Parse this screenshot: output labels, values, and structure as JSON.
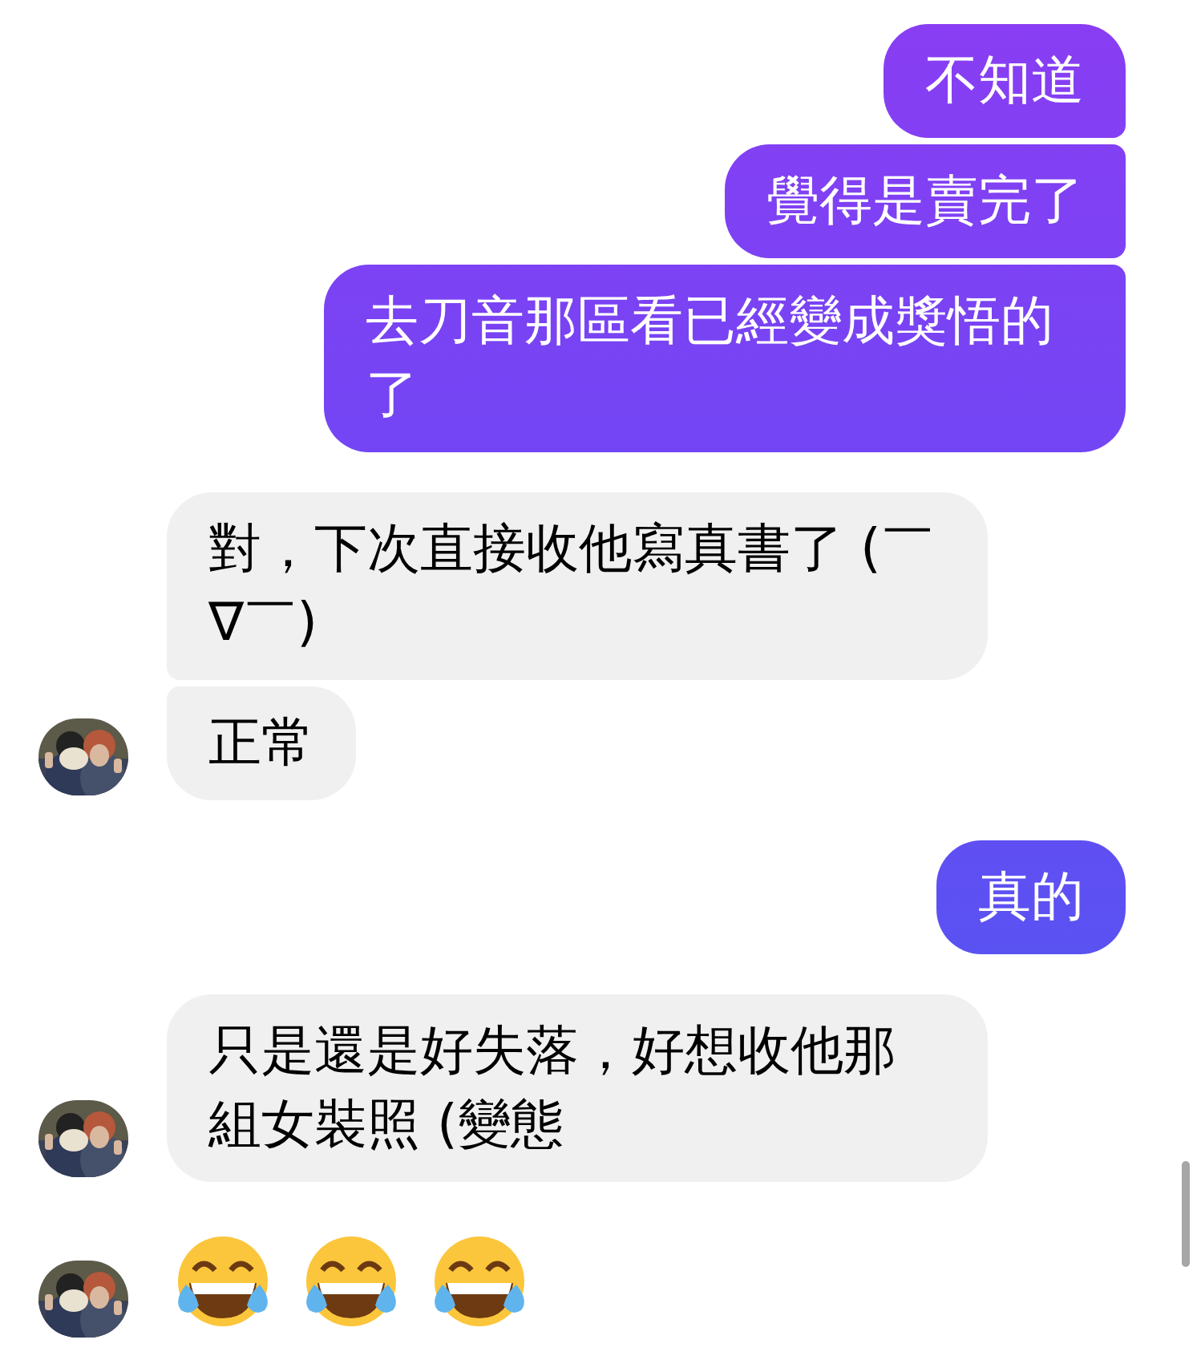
{
  "groups": [
    {
      "kind": "outgoing",
      "messages": [
        {
          "kind": "text",
          "text": "不知道"
        },
        {
          "kind": "text",
          "text": "覺得是賣完了"
        },
        {
          "kind": "text",
          "text": "去刀音那區看已經變成獎悟的了"
        }
      ]
    },
    {
      "kind": "incoming",
      "messages": [
        {
          "kind": "text",
          "text": "對，下次直接收他寫真書了 (￣∇￣)"
        },
        {
          "kind": "text",
          "text": "正常"
        }
      ]
    },
    {
      "kind": "outgoing",
      "messages": [
        {
          "kind": "text",
          "text": "真的"
        }
      ]
    },
    {
      "kind": "incoming",
      "messages": [
        {
          "kind": "text",
          "text": "只是還是好失落，好想收他那組女裝照 (變態"
        }
      ]
    },
    {
      "kind": "incoming",
      "messages": [
        {
          "kind": "emoji",
          "emojis": [
            {
              "kind": "tears_of_joy"
            },
            {
              "kind": "tears_of_joy"
            },
            {
              "kind": "tears_of_joy"
            }
          ]
        }
      ]
    }
  ]
}
